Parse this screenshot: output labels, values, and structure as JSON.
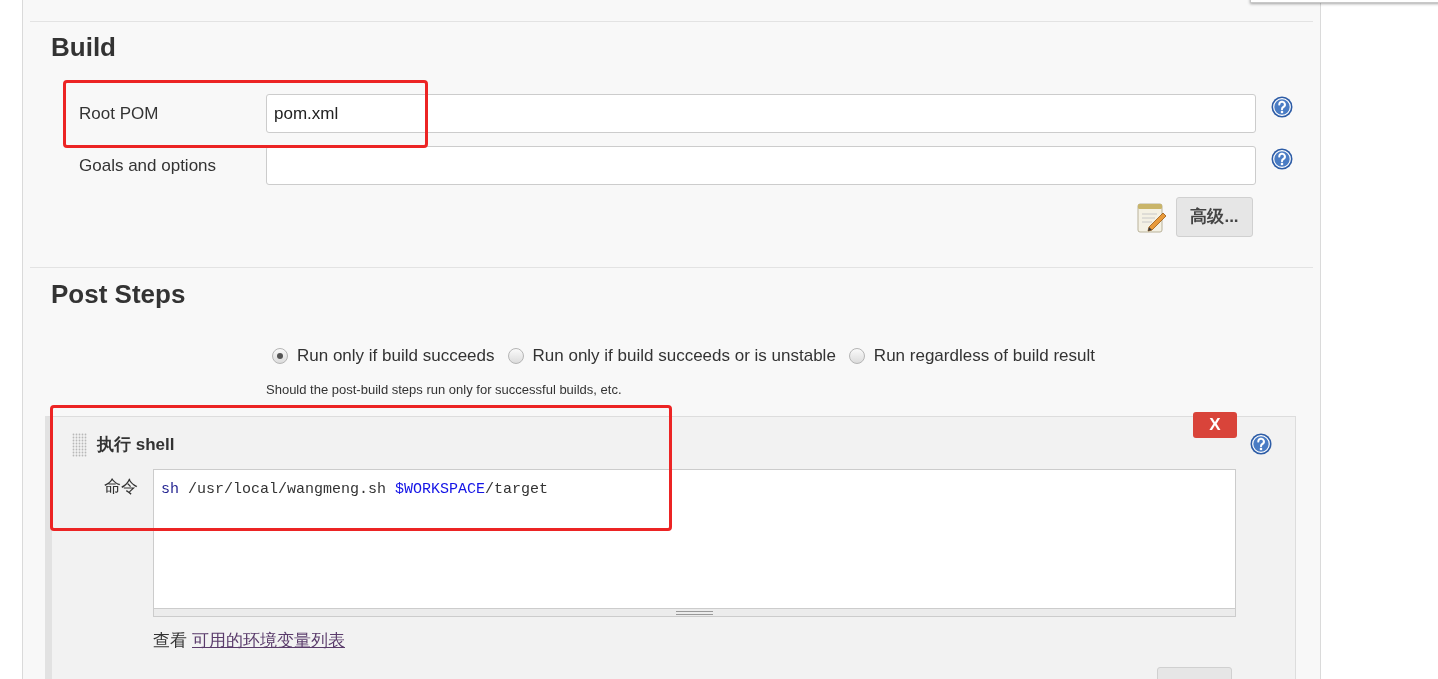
{
  "build": {
    "title": "Build",
    "fields": [
      {
        "label": "Root POM",
        "value": "pom.xml"
      },
      {
        "label": "Goals and options"
      }
    ],
    "advanced_button": "高级..."
  },
  "post_steps": {
    "title": "Post Steps",
    "options": [
      {
        "label": "Run only if build succeeds",
        "selected": true
      },
      {
        "label": "Run only if build succeeds or is unstable",
        "selected": false
      },
      {
        "label": "Run regardless of build result",
        "selected": false
      }
    ],
    "description": "Should the post-build steps run only for successful builds, etc."
  },
  "shell_step": {
    "title": "执行 shell",
    "delete_button": "X",
    "command_label": "命令",
    "command": [
      {
        "kind": "keyword",
        "text": "sh"
      },
      {
        "kind": "plain",
        "text": " /usr/local/wangmeng.sh "
      },
      {
        "kind": "variable",
        "text": "$WORKSPACE"
      },
      {
        "kind": "plain",
        "text": "/target"
      }
    ],
    "env_hint": "查看",
    "env_link": "可用的环境变量列表"
  }
}
